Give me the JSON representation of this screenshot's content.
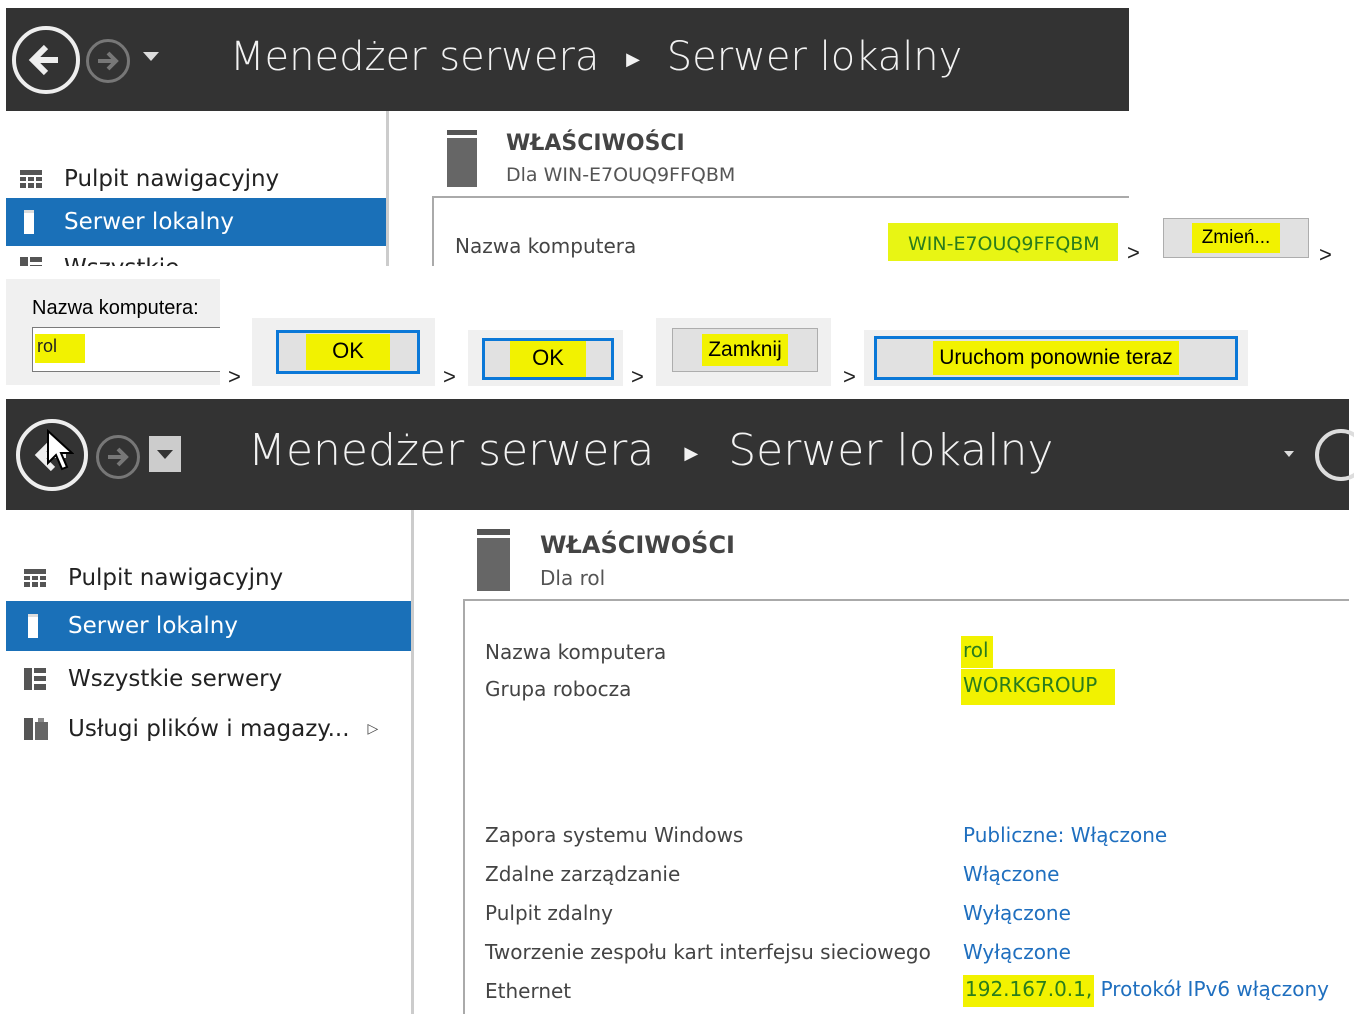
{
  "top_window": {
    "title_app": "Menedżer serwera",
    "title_page": "Serwer lokalny",
    "sidebar": [
      "Pulpit nawigacyjny",
      "Serwer lokalny",
      "Wszystkie"
    ],
    "properties_heading": "WŁAŚCIWOŚCI",
    "properties_sub": "Dla WIN-E7OUQ9FFQBM",
    "computer_name_label": "Nazwa komputera",
    "computer_name_value": "WIN-E7OUQ9FFQBM",
    "change_button": "Zmień..."
  },
  "steps": {
    "name_field_label": "Nazwa komputera:",
    "name_field_value": "rol",
    "ok_1": "OK",
    "ok_2": "OK",
    "close": "Zamknij",
    "restart": "Uruchom ponownie teraz",
    "arrow": ">"
  },
  "bottom_window": {
    "title_app": "Menedżer serwera",
    "title_page": "Serwer lokalny",
    "sidebar": [
      {
        "label": "Pulpit nawigacyjny",
        "icon": "dashboard-icon"
      },
      {
        "label": "Serwer lokalny",
        "icon": "server-icon"
      },
      {
        "label": "Wszystkie serwery",
        "icon": "servers-icon"
      },
      {
        "label": "Usługi plików i magazy...",
        "icon": "file-services-icon"
      }
    ],
    "properties_heading": "WŁAŚCIWOŚCI",
    "properties_sub": "Dla rol",
    "rows": [
      {
        "label": "Nazwa komputera",
        "value": "rol"
      },
      {
        "label": "Grupa robocza",
        "value": "WORKGROUP"
      },
      {
        "label": "Zapora systemu Windows",
        "value": "Publiczne: Włączone"
      },
      {
        "label": "Zdalne zarządzanie",
        "value": "Włączone"
      },
      {
        "label": "Pulpit zdalny",
        "value": "Wyłączone"
      },
      {
        "label": "Tworzenie zespołu kart interfejsu sieciowego",
        "value": "Wyłączone"
      },
      {
        "label": "Ethernet",
        "value_ip": "192.167.0.1,",
        "value_rest": "Protokół IPv6 włączony"
      }
    ]
  }
}
